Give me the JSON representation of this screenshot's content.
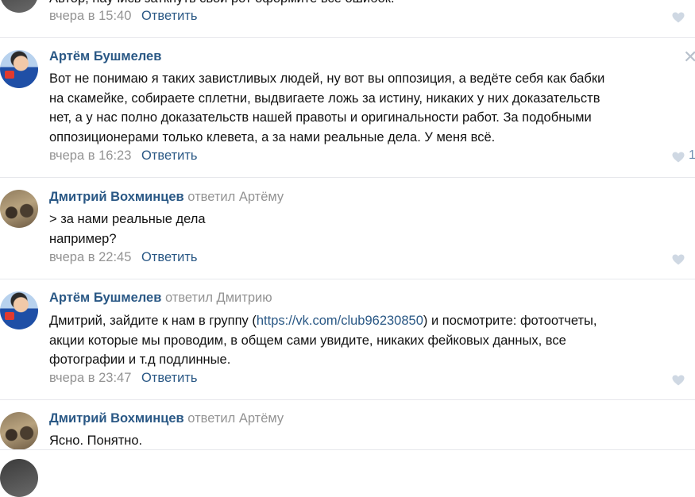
{
  "comments": [
    {
      "id": "c0",
      "author": "",
      "reply_to": "",
      "text": "Автор, научись заткнуть свой рот оформите всё ошибок.",
      "date": "вчера в 15:40",
      "reply_label": "Ответить",
      "likes": ""
    },
    {
      "id": "c1",
      "author": "Артём Бушмелев",
      "reply_to": "",
      "text": "Вот не понимаю я таких завистливых людей, ну вот вы оппозиция, а ведёте себя как бабки\nна скамейке, собираете сплетни, выдвигаете ложь за истину, никаких у них доказательств\nнет, а у нас полно доказательств нашей правоты и оригинальности работ. За подобными\nоппозиционерами только клевета, а за нами реальные дела. У меня всё.",
      "date": "вчера в 16:23",
      "reply_label": "Ответить",
      "likes": "1",
      "close_label": "✕"
    },
    {
      "id": "c2",
      "author": "Дмитрий Вохминцев",
      "reply_to": "ответил Артёму",
      "text": "> за нами реальные дела\nнапример?",
      "date": "вчера в 22:45",
      "reply_label": "Ответить",
      "likes": ""
    },
    {
      "id": "c3",
      "author": "Артём Бушмелев",
      "reply_to": "ответил Дмитрию",
      "text_before_link": "Дмитрий, зайдите к нам в группу (",
      "link": "https://vk.com/club96230850",
      "text_after_link": ") и посмотрите: фотоотчеты,\nакции которые мы проводим, в общем сами увидите, никаких фейковых данных, все\nфотографии и т.д подлинные.",
      "date": "вчера в 23:47",
      "reply_label": "Ответить",
      "likes": ""
    },
    {
      "id": "c4",
      "author": "Дмитрий Вохминцев",
      "reply_to": "ответил Артёму",
      "text": "Ясно. Понятно.",
      "date": "",
      "reply_label": "",
      "likes": ""
    }
  ],
  "colors": {
    "link": "#2a5885",
    "muted": "#939393",
    "divider": "#e7e8ec",
    "like": "#cfd8e3"
  }
}
